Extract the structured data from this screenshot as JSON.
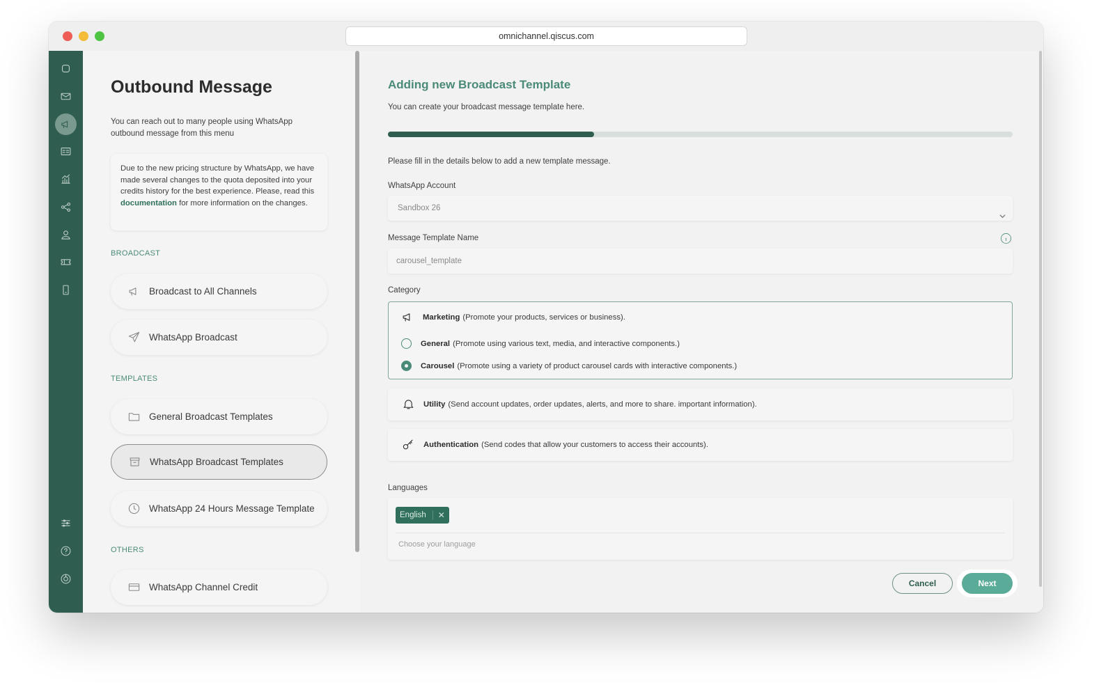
{
  "browser": {
    "url": "omnichannel.qiscus.com"
  },
  "rail": {
    "icons": [
      "chat-icon",
      "mail-icon",
      "megaphone-icon",
      "contact-card-icon",
      "analytics-icon",
      "integration-icon",
      "agent-icon",
      "ticket-icon",
      "mobile-icon",
      "settings-sliders-icon",
      "help-icon",
      "logout-icon"
    ],
    "active": "megaphone-icon"
  },
  "sidebar": {
    "title": "Outbound Message",
    "description": "You can reach out to many people using WhatsApp outbound message from this menu",
    "notice": {
      "text_before": "Due to the new pricing structure by WhatsApp, we have made several changes to the quota deposited into your credits history for the best experience. Please, read this ",
      "link": "documentation",
      "text_after": " for more information on the changes."
    },
    "sections": {
      "broadcast": "BROADCAST",
      "templates": "TEMPLATES",
      "others": "OTHERS"
    },
    "items": {
      "broadcast_all": "Broadcast to All Channels",
      "whatsapp_broadcast": "WhatsApp Broadcast",
      "general_templates": "General Broadcast Templates",
      "whatsapp_templates": "WhatsApp Broadcast Templates",
      "whatsapp_24h": "WhatsApp 24 Hours Message Template",
      "channel_credit": "WhatsApp Channel Credit"
    }
  },
  "form": {
    "title": "Adding new Broadcast Template",
    "subtitle": "You can create your broadcast message template here.",
    "progress": 0.33,
    "hint": "Please fill in the details below to add a new template message.",
    "account_label": "WhatsApp Account",
    "account_value": "Sandbox 26",
    "name_label": "Message Template Name",
    "name_value": "carousel_template",
    "category_label": "Category",
    "categories": {
      "marketing": {
        "name": "Marketing",
        "desc": "(Promote your products, services or business)."
      },
      "general": {
        "name": "General",
        "desc": "(Promote using various text, media, and interactive components.)"
      },
      "carousel": {
        "name": "Carousel",
        "desc": "(Promote using a variety of product carousel cards with interactive components.)"
      },
      "utility": {
        "name": "Utility",
        "desc": "(Send account updates, order updates, alerts, and more to share. important information)."
      },
      "authentication": {
        "name": "Authentication",
        "desc": "(Send codes that allow your customers to access their accounts)."
      }
    },
    "selected_subcategory": "Carousel",
    "languages_label": "Languages",
    "language_chip": "English",
    "language_chip_remove": "✕",
    "language_placeholder": "Choose your language",
    "cancel_label": "Cancel",
    "next_label": "Next"
  },
  "colors": {
    "brand": "#2f5e50",
    "accent": "#4a8a78",
    "next_button": "#5aab98"
  }
}
